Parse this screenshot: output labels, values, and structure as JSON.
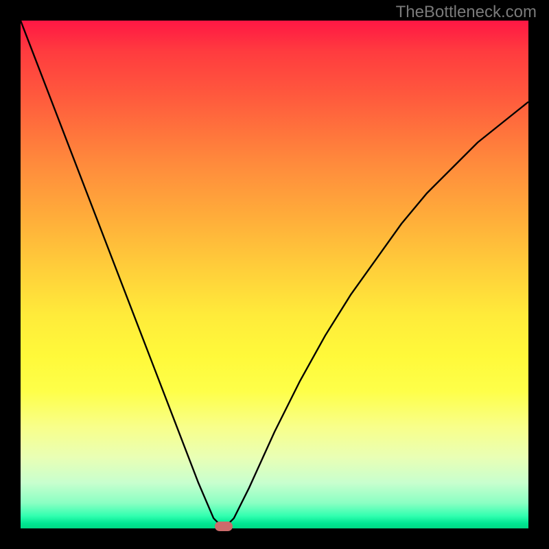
{
  "watermark": "TheBottleneck.com",
  "chart_data": {
    "type": "line",
    "title": "",
    "xlabel": "",
    "ylabel": "",
    "x": [
      0.0,
      0.05,
      0.1,
      0.15,
      0.2,
      0.25,
      0.3,
      0.35,
      0.38,
      0.4,
      0.42,
      0.45,
      0.5,
      0.55,
      0.6,
      0.65,
      0.7,
      0.75,
      0.8,
      0.85,
      0.9,
      0.95,
      1.0
    ],
    "series": [
      {
        "name": "bottleneck-curve",
        "values": [
          1.0,
          0.87,
          0.74,
          0.61,
          0.48,
          0.35,
          0.22,
          0.09,
          0.02,
          0.0,
          0.02,
          0.08,
          0.19,
          0.29,
          0.38,
          0.46,
          0.53,
          0.6,
          0.66,
          0.71,
          0.76,
          0.8,
          0.84
        ]
      }
    ],
    "xlim": [
      0,
      1
    ],
    "ylim": [
      0,
      1
    ],
    "marker": {
      "x": 0.4,
      "y": 0.0
    },
    "gradient_stops": [
      {
        "pos": 0.0,
        "color": "#ff1744"
      },
      {
        "pos": 0.5,
        "color": "#ffeb3a"
      },
      {
        "pos": 1.0,
        "color": "#00d884"
      }
    ]
  }
}
